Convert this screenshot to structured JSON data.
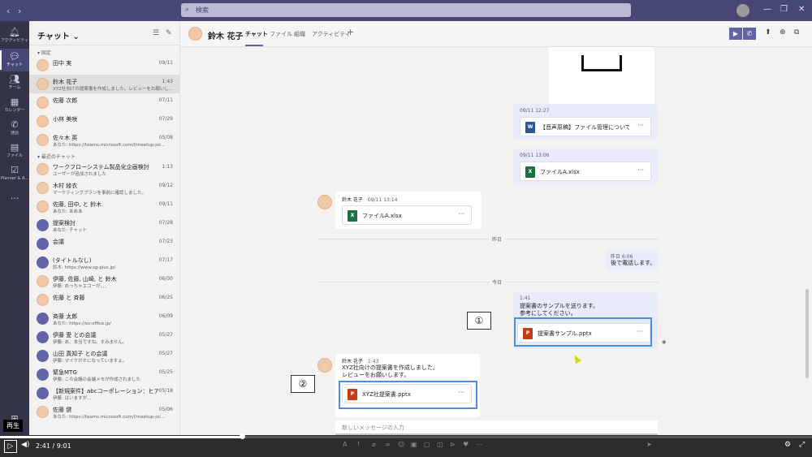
{
  "titlebar": {
    "search_placeholder": "検索",
    "back_icon": "chevron-left-icon",
    "forward_icon": "chevron-right-icon"
  },
  "rail": {
    "items": [
      {
        "label": "アクティビティ",
        "icon": "bell-icon"
      },
      {
        "label": "チャット",
        "icon": "chat-icon"
      },
      {
        "label": "チーム",
        "icon": "teams-icon"
      },
      {
        "label": "カレンダー",
        "icon": "calendar-icon"
      },
      {
        "label": "通話",
        "icon": "phone-icon"
      },
      {
        "label": "ファイル",
        "icon": "file-icon"
      },
      {
        "label": "Planner & A...",
        "icon": "planner-icon"
      }
    ],
    "more": "..."
  },
  "chatlist": {
    "title": "チャット",
    "pinned_label": "固定",
    "recent_label": "最近のチャット",
    "pinned": [
      {
        "name": "田中 実",
        "preview": "",
        "date": "09/11"
      },
      {
        "name": "鈴木 花子",
        "preview": "XYZ社向けの提案書を作成しました。レビューをお願いし...",
        "date": "1:43",
        "selected": true
      },
      {
        "name": "佐藤 次郎",
        "preview": "",
        "date": "07/11"
      },
      {
        "name": "小林 美咲",
        "preview": "",
        "date": "07/29"
      },
      {
        "name": "佐々木 英",
        "preview": "あなた: https://teams.microsoft.com/l/meetup-joi...",
        "date": "05/08"
      }
    ],
    "recent": [
      {
        "name": "ワークフローシステム製品化企画検討",
        "preview": "ユーザーが追加されました",
        "date": "1:13",
        "group": false
      },
      {
        "name": "木村 綾衣",
        "preview": "マーケティングプランを事前に確認しました。",
        "date": "09/12",
        "group": false
      },
      {
        "name": "佐藤, 田中, と 鈴木",
        "preview": "あなた: あああ",
        "date": "09/11",
        "group": false
      },
      {
        "name": "提案検討",
        "preview": "あなた: チャット",
        "date": "07/28",
        "group": true
      },
      {
        "name": "会議",
        "preview": "",
        "date": "07/23",
        "group": true
      },
      {
        "name": "(タイトルなし)",
        "preview": "鈴木: https://www.sg-plus.jp/",
        "date": "07/17",
        "group": true
      },
      {
        "name": "伊藤, 佐藤, 山崎, と 鈴木",
        "preview": "伊藤: めっちゃエコーが、、、",
        "date": "06/30",
        "group": false
      },
      {
        "name": "佐藤 と 斉藤",
        "preview": "",
        "date": "06/25",
        "group": false
      },
      {
        "name": "斉藤 太郎",
        "preview": "あなた: https://ez-office.jp/",
        "date": "06/09",
        "group": true
      },
      {
        "name": "伊藤 愛 との会議",
        "preview": "伊藤: あ、本当ですね。すみません。",
        "date": "05/27",
        "group": true
      },
      {
        "name": "山田 真知子 との会議",
        "preview": "伊藤: マイクがオになっていますよ。",
        "date": "05/27",
        "group": true
      },
      {
        "name": "緊急MTG",
        "preview": "伊藤: この会議の会議メモが作成されました",
        "date": "05/25",
        "group": true
      },
      {
        "name": "【新規案件】abcコーポレーション：ヒアリン...",
        "preview": "伊藤: はいますが...",
        "date": "05/18",
        "group": true
      },
      {
        "name": "佐藤 健",
        "preview": "あなた: https://teams.microsoft.com/l/meetup-joi...",
        "date": "05/06",
        "group": false
      }
    ]
  },
  "header": {
    "name": "鈴木 花子",
    "tabs": [
      "チャット",
      "ファイル",
      "組織",
      "アクティビティ"
    ],
    "add_tab": "+"
  },
  "messages": {
    "m1": {
      "time": "09/11 12:27",
      "file": "【音声原稿】ファイル管理について知...",
      "type": "W"
    },
    "m2": {
      "time": "09/11 13:06",
      "file": "ファイルA.xlsx",
      "type": "X"
    },
    "m3": {
      "sender": "鈴木 花子",
      "time": "09/11 13:14",
      "file": "ファイルA.xlsx",
      "type": "X"
    },
    "divider_yesterday": "昨日",
    "m4": {
      "time": "昨日 6:06",
      "text": "後で電話します。"
    },
    "divider_today": "今日",
    "m5": {
      "time": "1:41",
      "text1": "提案書のサンプルを送ります。",
      "text2": "参考にしてください。",
      "file": "提案書サンプル.pptx",
      "type": "P"
    },
    "m6": {
      "sender": "鈴木 花子",
      "time": "1:43",
      "text1": "XYZ社向けの提案書を作成しました。",
      "text2": "レビューをお願いします。",
      "file": "XYZ社提案書.pptx",
      "type": "P"
    },
    "more": "···",
    "read_receipt": "◉"
  },
  "annotations": {
    "one": "①",
    "two": "②"
  },
  "compose": {
    "placeholder": "新しいメッセージの入力"
  },
  "video": {
    "tooltip": "再生",
    "current": "2:41",
    "duration": "9:01",
    "separator": "/",
    "progress_fraction": 0.298
  }
}
